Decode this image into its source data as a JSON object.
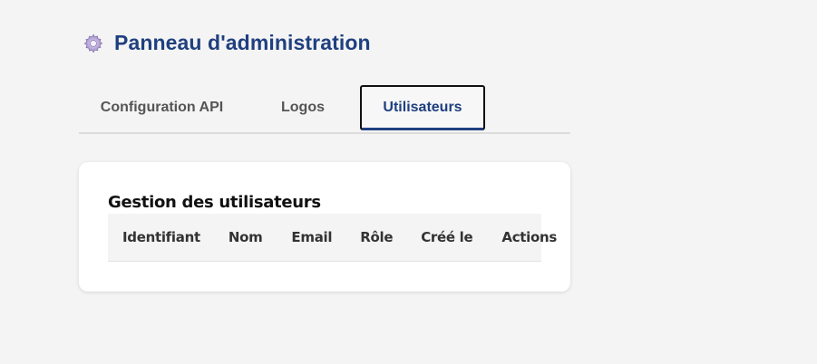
{
  "header": {
    "title": "Panneau d'administration",
    "icon": "gear-icon"
  },
  "tabs": [
    {
      "label": "Configuration API",
      "active": false
    },
    {
      "label": "Logos",
      "active": false
    },
    {
      "label": "Utilisateurs",
      "active": true
    }
  ],
  "users_panel": {
    "title": "Gestion des utilisateurs",
    "columns": [
      "Identifiant",
      "Nom",
      "Email",
      "Rôle",
      "Créé le",
      "Actions"
    ],
    "rows": []
  },
  "colors": {
    "accent": "#1f3f7f",
    "background": "#f4f4f4",
    "card": "#ffffff"
  }
}
